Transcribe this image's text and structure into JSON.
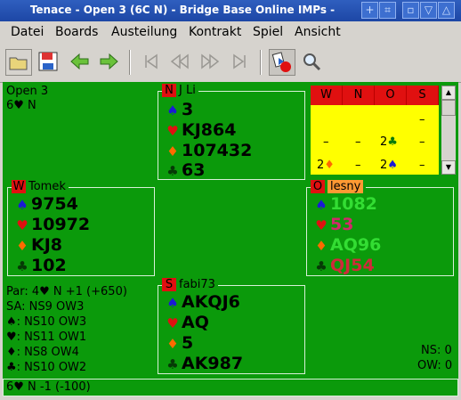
{
  "window": {
    "title": "Tenace - Open 3 (6C N) - Bridge Base Online IMPs  -",
    "buttons": [
      "+",
      "⌗",
      "▫",
      "▽",
      "△",
      "×"
    ]
  },
  "menu": [
    "Datei",
    "Boards",
    "Austeilung",
    "Kontrakt",
    "Spiel",
    "Ansicht"
  ],
  "toolbar": {
    "icons": [
      "open-folder-icon",
      "save-disk-icon",
      "back-arrow-icon",
      "forward-arrow-icon",
      "first-icon",
      "rewind-icon",
      "fast-forward-icon",
      "last-icon",
      "play-record-icon",
      "search-icon"
    ]
  },
  "board": {
    "name": "Open 3",
    "contract_line": "6♥ N"
  },
  "bidding": {
    "headers": [
      "W",
      "N",
      "O",
      "S"
    ],
    "rows": [
      [
        "",
        "",
        "",
        "–"
      ],
      [
        "–",
        "–",
        "2♣",
        "–"
      ],
      [
        "2♦",
        "–",
        "2♠",
        "–"
      ]
    ]
  },
  "hands": {
    "north": {
      "seat": "N",
      "player": "J Li",
      "spades": "3",
      "hearts": "KJ864",
      "diamonds": "107432",
      "clubs": "63"
    },
    "west": {
      "seat": "W",
      "player": "Tomek",
      "spades": "9754",
      "hearts": "10972",
      "diamonds": "KJ8",
      "clubs": "102"
    },
    "east": {
      "seat": "O",
      "player": "lesny",
      "spades": "1082",
      "hearts": "53",
      "diamonds": "AQ96",
      "clubs": "QJ54"
    },
    "south": {
      "seat": "S",
      "player": "fabi73",
      "spades": "AKQJ6",
      "hearts": "AQ",
      "diamonds": "5",
      "clubs": "AK987"
    }
  },
  "analysis": {
    "par": "Par: 4♥ N +1 (+650)",
    "lines": [
      "SA: NS9 OW3",
      "♠: NS10 OW3",
      "♥: NS11 OW1",
      "♦: NS8 OW4",
      "♣: NS10 OW2"
    ]
  },
  "score": {
    "ns": "NS: 0",
    "ow": "OW: 0"
  },
  "status": "6♥ N -1 (-100)",
  "colors": {
    "table_green": "#0b9a0b",
    "seat_red": "#e01010",
    "bidding_yellow": "#ffff00",
    "east_label": "#ff9933"
  }
}
